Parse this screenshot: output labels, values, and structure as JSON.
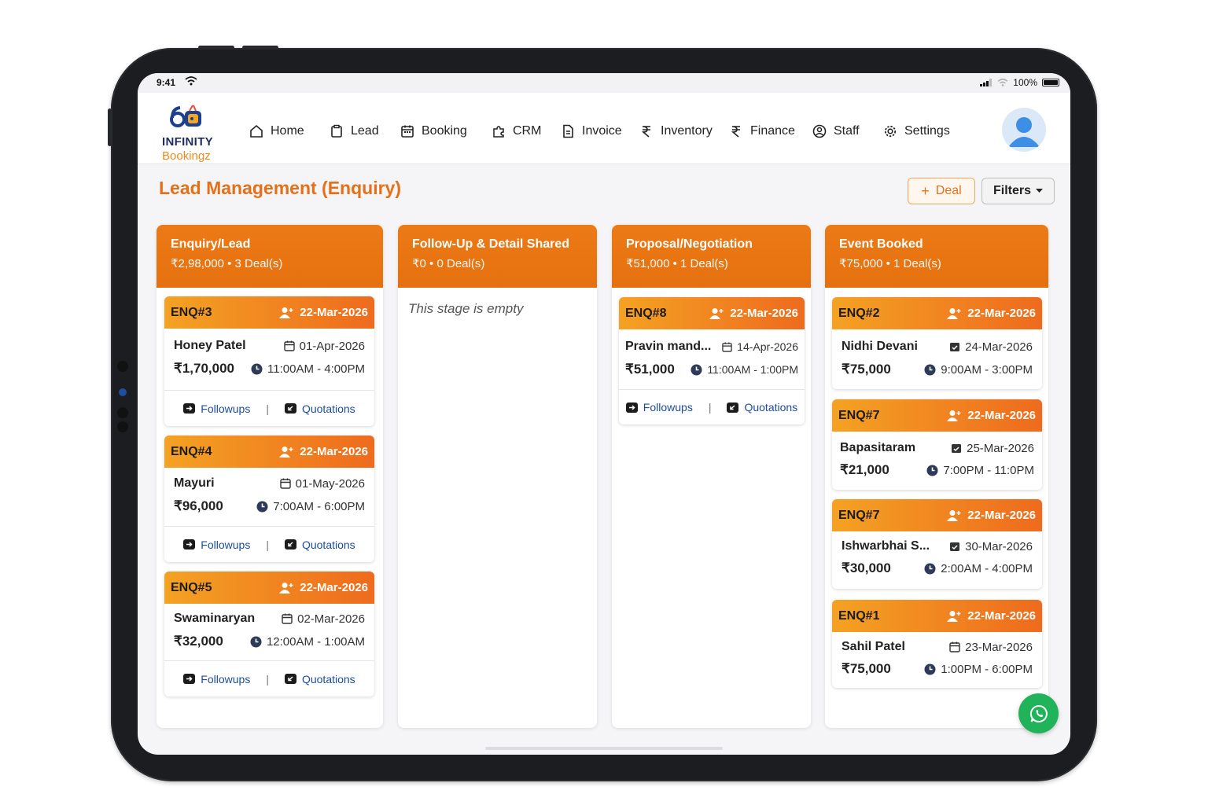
{
  "status": {
    "time": "9:41",
    "battery": "100%"
  },
  "brand": {
    "line1": "INFINITY",
    "line2": "Bookingz"
  },
  "nav": [
    {
      "label": "Home",
      "icon": "home-icon"
    },
    {
      "label": "Lead",
      "icon": "clipboard-icon"
    },
    {
      "label": "Booking",
      "icon": "calendar-icon"
    },
    {
      "label": "CRM",
      "icon": "puzzle-icon"
    },
    {
      "label": "Invoice",
      "icon": "document-icon"
    },
    {
      "label": "Inventory",
      "icon": "rupee-icon"
    },
    {
      "label": "Finance",
      "icon": "rupee-icon"
    },
    {
      "label": "Staff",
      "icon": "user-circle-icon"
    },
    {
      "label": "Settings",
      "icon": "gear-icon"
    }
  ],
  "page": {
    "title": "Lead Management (Enquiry)",
    "deal_label": "Deal",
    "filters_label": "Filters"
  },
  "columns": [
    {
      "title": "Enquiry/Lead",
      "summary": "₹2,98,000 • 3 Deal(s)"
    },
    {
      "title": "Follow-Up & Detail Shared",
      "summary": "₹0 • 0 Deal(s)",
      "empty": "This stage is empty"
    },
    {
      "title": "Proposal/Negotiation",
      "summary": "₹51,000 • 1 Deal(s)"
    },
    {
      "title": "Event Booked",
      "summary": "₹75,000 • 1 Deal(s)"
    }
  ],
  "links": {
    "followups": "Followups",
    "quotations": "Quotations",
    "separator": "|"
  },
  "cards": [
    {
      "id": "ENQ#3",
      "created": "22-Mar-2026",
      "name": "Honey Patel",
      "event_date": "01-Apr-2026",
      "amount": "₹1,70,000",
      "time": "11:00AM - 4:00PM"
    },
    {
      "id": "ENQ#4",
      "created": "22-Mar-2026",
      "name": "Mayuri",
      "event_date": "01-May-2026",
      "amount": "₹96,000",
      "time": "7:00AM - 6:00PM"
    },
    {
      "id": "ENQ#5",
      "created": "22-Mar-2026",
      "name": "Swaminaryan",
      "event_date": "02-Mar-2026",
      "amount": "₹32,000",
      "time": "12:00AM - 1:00AM"
    },
    {
      "id": "ENQ#8",
      "created": "22-Mar-2026",
      "name": "Pravin mand...",
      "event_date": "14-Apr-2026",
      "amount": "₹51,000",
      "time": "11:00AM - 1:00PM"
    },
    {
      "id": "ENQ#2",
      "created": "22-Mar-2026",
      "name": "Nidhi Devani",
      "event_date": "24-Mar-2026",
      "amount": "₹75,000",
      "time": "9:00AM - 3:00PM"
    },
    {
      "id": "ENQ#7",
      "created": "22-Mar-2026",
      "name": "Bapasitaram",
      "event_date": "25-Mar-2026",
      "amount": "₹21,000",
      "time": "7:00PM - 11:0PM"
    },
    {
      "id": "ENQ#7",
      "created": "22-Mar-2026",
      "name": "Ishwarbhai S...",
      "event_date": "30-Mar-2026",
      "amount": "₹30,000",
      "time": "2:00AM - 4:00PM"
    },
    {
      "id": "ENQ#1",
      "created": "22-Mar-2026",
      "name": "Sahil Patel",
      "event_date": "23-Mar-2026",
      "amount": "₹75,000",
      "time": "1:00PM - 6:00PM"
    }
  ],
  "colors": {
    "accent": "#e4711a",
    "header_orange": "#ec7a16",
    "link_blue": "#1d4c9c",
    "whatsapp": "#21b35a"
  }
}
